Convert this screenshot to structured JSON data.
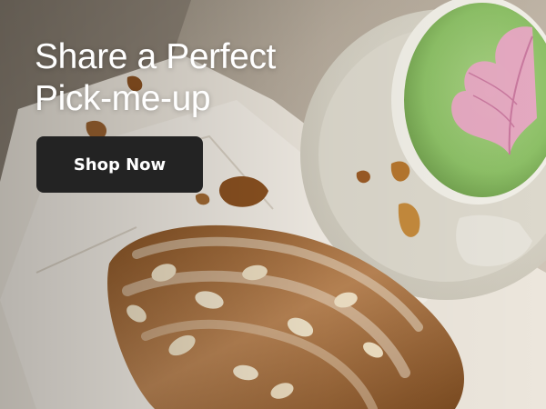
{
  "banner": {
    "headline_line1": "Share a Perfect",
    "headline_line2": "Pick-me-up",
    "cta_label": "Shop Now"
  },
  "colors": {
    "cta_background": "#232323",
    "text": "#ffffff",
    "matcha": "#8fc06a",
    "latte_art": "#e8a7c4"
  }
}
